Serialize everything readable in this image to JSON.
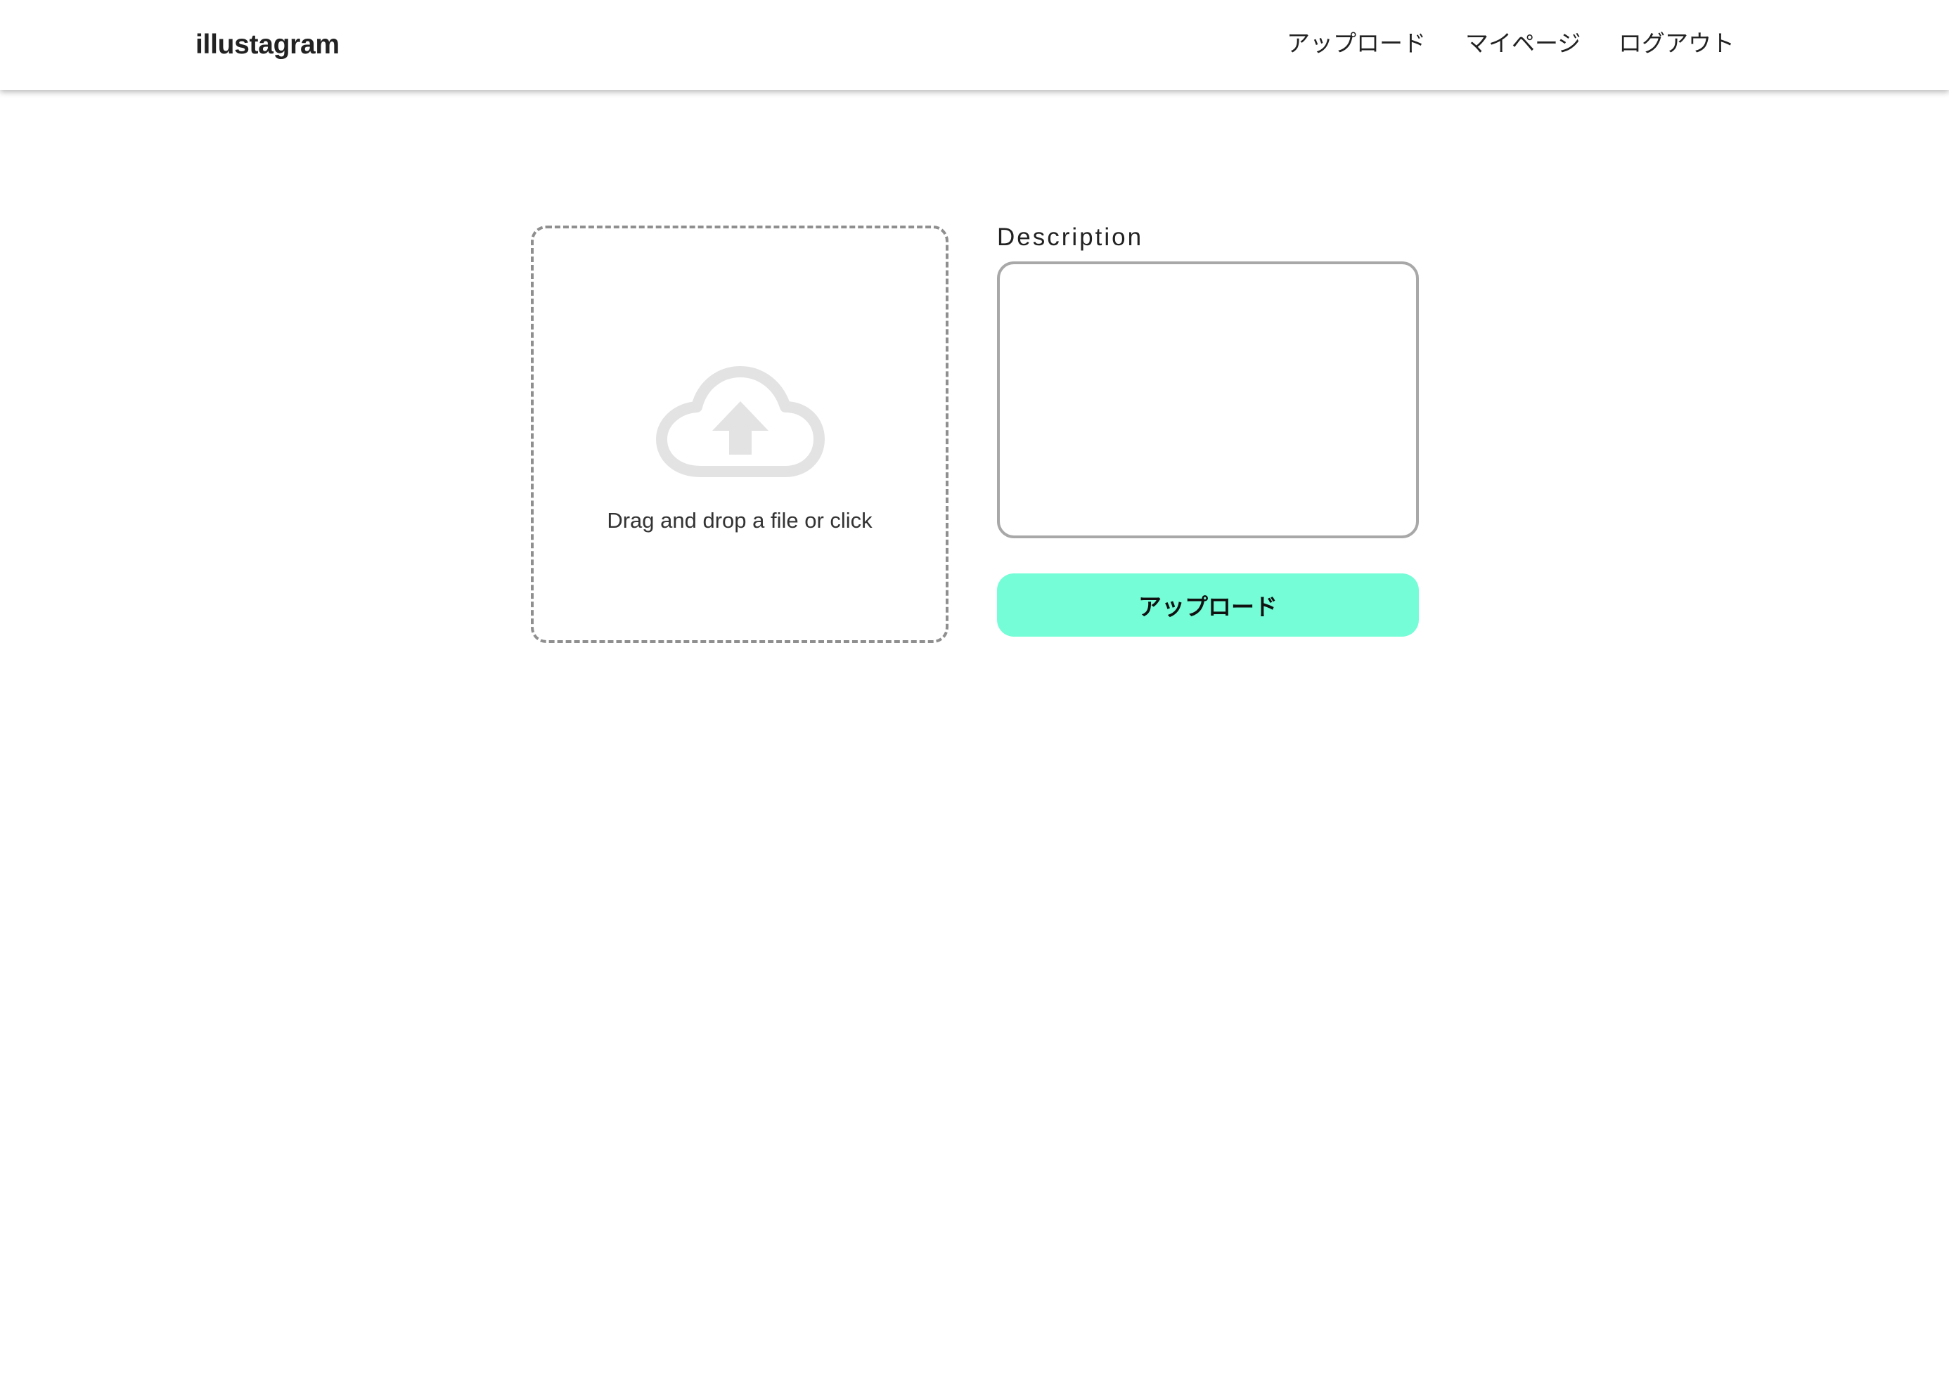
{
  "app": {
    "brand": "illustagram"
  },
  "nav": {
    "items": [
      {
        "label": "アップロード"
      },
      {
        "label": "マイページ"
      },
      {
        "label": "ログアウト"
      }
    ]
  },
  "upload_form": {
    "dropzone": {
      "text": "Drag and drop a file or click",
      "icon": "cloud-upload-icon"
    },
    "description": {
      "label": "Description",
      "value": "",
      "placeholder": ""
    },
    "submit_label": "アップロード"
  },
  "colors": {
    "accent": "#74fdd6",
    "icon_gray": "#e3e3e3",
    "border_dashed": "#8f8f8f",
    "border_input": "#a8a8a8"
  }
}
